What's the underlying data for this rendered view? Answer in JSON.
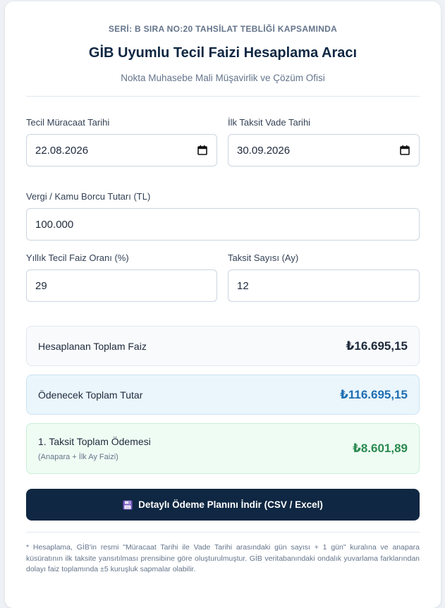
{
  "header": {
    "series": "SERİ: B SIRA NO:20 TAHSİLAT TEBLİĞİ KAPSAMINDA",
    "title": "GİB Uyumlu Tecil Faizi Hesaplama Aracı",
    "subtitle": "Nokta Muhasebe Mali Müşavirlik ve Çözüm Ofisi"
  },
  "form": {
    "application_date": {
      "label": "Tecil Müracaat Tarihi",
      "value": "22.08.2026"
    },
    "first_due_date": {
      "label": "İlk Taksit Vade Tarihi",
      "value": "30.09.2026"
    },
    "debt_amount": {
      "label": "Vergi / Kamu Borcu Tutarı (TL)",
      "value": "100.000"
    },
    "annual_rate": {
      "label": "Yıllık Tecil Faiz Oranı (%)",
      "value": "29"
    },
    "installments": {
      "label": "Taksit Sayısı (Ay)",
      "value": "12"
    }
  },
  "results": {
    "total_interest": {
      "label": "Hesaplanan Toplam Faiz",
      "value": "₺16.695,15"
    },
    "total_payable": {
      "label": "Ödenecek Toplam Tutar",
      "value": "₺116.695,15"
    },
    "first_installment": {
      "label": "1. Taksit Toplam Ödemesi",
      "sublabel": "(Anapara + İlk Ay Faizi)",
      "value": "₺8.601,89"
    }
  },
  "download_button": {
    "label": "Detaylı Ödeme Planını İndir (CSV / Excel)",
    "icon": "floppy-disk-icon"
  },
  "footnote": "* Hesaplama, GİB'in resmi \"Müracaat Tarihi ile Vade Tarihi arasındaki gün sayısı + 1 gün\" kuralına ve anapara küsüratının ilk taksite yansıtılması prensibine göre oluşturulmuştur. GİB veritabanındaki ondalık yuvarlama farklarından dolayı faiz toplamında ±5 kuruşluk sapmalar olabilir.",
  "colors": {
    "primary": "#0f2742",
    "total_payable": "#1f6fb2",
    "first_installment": "#2a8a50"
  }
}
